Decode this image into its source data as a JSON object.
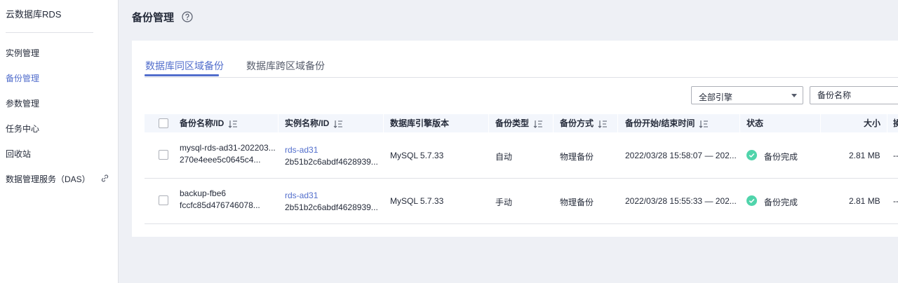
{
  "sidebar": {
    "title": "云数据库RDS",
    "items": [
      {
        "label": "实例管理"
      },
      {
        "label": "备份管理"
      },
      {
        "label": "参数管理"
      },
      {
        "label": "任务中心"
      },
      {
        "label": "回收站"
      },
      {
        "label": "数据管理服务（DAS）"
      }
    ],
    "active_index": 1
  },
  "page": {
    "title": "备份管理"
  },
  "tabs": [
    {
      "label": "数据库同区域备份",
      "active": true
    },
    {
      "label": "数据库跨区域备份",
      "active": false
    }
  ],
  "filters": {
    "engine_select": "全部引擎",
    "search_placeholder": "备份名称"
  },
  "table": {
    "columns": [
      "备份名称/ID",
      "实例名称/ID",
      "数据库引擎版本",
      "备份类型",
      "备份方式",
      "备份开始/结束时间",
      "状态",
      "大小",
      "操"
    ],
    "rows": [
      {
        "backup_name": "mysql-rds-ad31-202203...",
        "backup_id": "270e4eee5c0645c4...",
        "instance_name": "rds-ad31",
        "instance_id": "2b51b2c6abdf4628939...",
        "engine": "MySQL 5.7.33",
        "type": "自动",
        "method": "物理备份",
        "time": "2022/03/28 15:58:07 — 202...",
        "status": "备份完成",
        "size": "2.81 MB",
        "action": "--"
      },
      {
        "backup_name": "backup-fbe6",
        "backup_id": "fccfc85d476746078...",
        "instance_name": "rds-ad31",
        "instance_id": "2b51b2c6abdf4628939...",
        "engine": "MySQL 5.7.33",
        "type": "手动",
        "method": "物理备份",
        "time": "2022/03/28 15:55:33 — 202...",
        "status": "备份完成",
        "size": "2.81 MB",
        "action": "--"
      }
    ]
  },
  "colors": {
    "accent": "#526ecc",
    "success": "#50d4ab",
    "bg": "#eef0f5"
  }
}
